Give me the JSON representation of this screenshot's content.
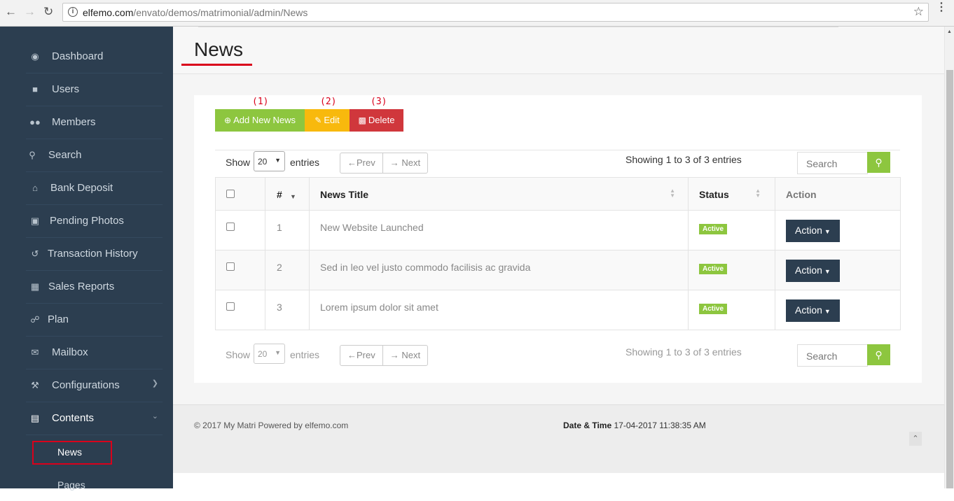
{
  "browser": {
    "url_host": "elfemo.com",
    "url_path": "/envato/demos/matrimonial/admin/News"
  },
  "sidebar": {
    "items": [
      {
        "label": "Dashboard",
        "icon": "dashboard-icon"
      },
      {
        "label": "Users",
        "icon": "user-icon"
      },
      {
        "label": "Members",
        "icon": "members-icon"
      },
      {
        "label": "Search",
        "icon": "search-icon"
      },
      {
        "label": "Bank Deposit",
        "icon": "bank-icon"
      },
      {
        "label": "Pending Photos",
        "icon": "photo-icon"
      },
      {
        "label": "Transaction History",
        "icon": "history-icon"
      },
      {
        "label": "Sales Reports",
        "icon": "table-icon"
      },
      {
        "label": "Plan",
        "icon": "cart-icon"
      },
      {
        "label": "Mailbox",
        "icon": "envelope-icon"
      },
      {
        "label": "Configurations",
        "icon": "wrench-icon"
      },
      {
        "label": "Contents",
        "icon": "newspaper-icon"
      }
    ],
    "sub_items": [
      {
        "label": "News"
      },
      {
        "label": "Pages"
      }
    ]
  },
  "page": {
    "title": "News"
  },
  "annotations": [
    "(1)",
    "(2)",
    "(3)"
  ],
  "toolbar": {
    "add_label": "Add New News",
    "edit_label": "Edit",
    "delete_label": "Delete"
  },
  "controls": {
    "show_label": "Show",
    "page_size": "20",
    "entries_label": "entries",
    "prev_label": "←Prev",
    "next_label": "→ Next",
    "showing_text": "Showing 1 to 3 of 3 entries",
    "search_placeholder": "Search"
  },
  "table": {
    "headers": {
      "num": "#",
      "title": "News Title",
      "status": "Status",
      "action": "Action"
    },
    "rows": [
      {
        "num": "1",
        "title": "New Website Launched",
        "status": "Active",
        "action": "Action"
      },
      {
        "num": "2",
        "title": "Sed in leo vel justo commodo facilisis ac gravida",
        "status": "Active",
        "action": "Action"
      },
      {
        "num": "3",
        "title": "Lorem ipsum dolor sit amet",
        "status": "Active",
        "action": "Action"
      }
    ]
  },
  "footer": {
    "copyright": "© 2017 My Matri Powered by",
    "powered_link": "elfemo.com",
    "datetime_label": "Date & Time",
    "datetime_value": "17-04-2017 11:38:35 AM"
  },
  "colors": {
    "sidebar": "#2c3e50",
    "accent_green": "#8dc63f",
    "edit_yellow": "#f8b90d",
    "delete_red": "#d0373c",
    "highlight_red": "#d9001b"
  }
}
